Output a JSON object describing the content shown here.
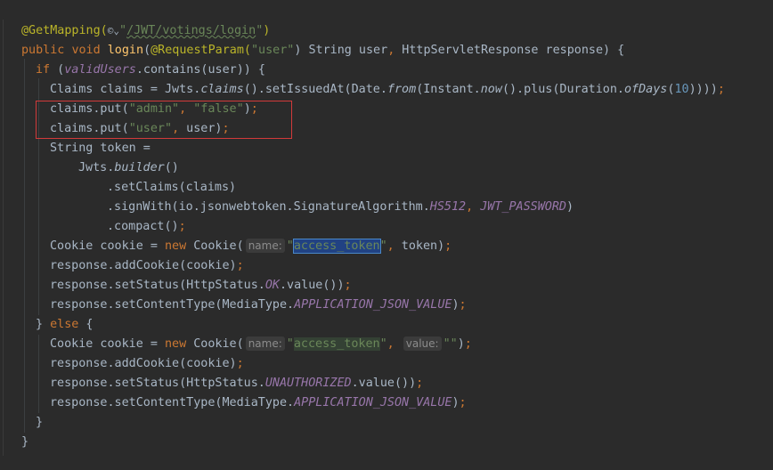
{
  "code": {
    "l1": {
      "ann": "@GetMapping(",
      "icon": "©⌄",
      "q1": "\"",
      "url": "/JWT/votings/login",
      "q2": "\"",
      "end": ")"
    },
    "l2": {
      "kw1": "public",
      "sp1": " ",
      "kw2": "void",
      "sp2": " ",
      "fn": "login",
      "p1": "(",
      "ann": "@RequestParam(",
      "str": "\"user\"",
      "p2": ") String user",
      "comma": ",",
      "rest": " HttpServletResponse response) {"
    },
    "l3": {
      "kw": "if",
      "p1": " (",
      "field": "validUsers",
      "rest": ".contains(user)) {"
    },
    "l4": {
      "a": "Claims claims = Jwts.",
      "m1": "claims",
      "b": "().setIssuedAt(Date.",
      "m2": "from",
      "c": "(Instant.",
      "m3": "now",
      "d": "().plus(Duration.",
      "m4": "ofDays",
      "e": "(",
      "num": "10",
      "f": "))))",
      "semi": ";"
    },
    "l5": {
      "a": "claims.put(",
      "s1": "\"admin\"",
      "comma": ",",
      "s2": " \"false\"",
      "b": ")",
      "semi": ";"
    },
    "l6": {
      "a": "claims.put(",
      "s1": "\"user\"",
      "comma": ",",
      "b": " user)",
      "semi": ";"
    },
    "l7": {
      "a": "String token ="
    },
    "l8": {
      "a": "Jwts.",
      "m": "builder",
      "b": "()"
    },
    "l9": {
      "a": ".setClaims(claims)"
    },
    "l10": {
      "a": ".signWith(io.jsonwebtoken.SignatureAlgorithm.",
      "f1": "HS512",
      "comma": ",",
      "f2": " JWT_PASSWORD",
      "b": ")"
    },
    "l11": {
      "a": ".compact()",
      "semi": ";"
    },
    "l12": {
      "a": "Cookie cookie = ",
      "kw": "new",
      "b": " Cookie(",
      "hint": "name:",
      "q1": "\"",
      "s": "access_token",
      "q2": "\"",
      "comma": ",",
      "c": " token)",
      "semi": ";"
    },
    "l13": {
      "a": "response.addCookie(cookie)",
      "semi": ";"
    },
    "l14": {
      "a": "response.setStatus(HttpStatus.",
      "f": "OK",
      "b": ".value())",
      "semi": ";"
    },
    "l15": {
      "a": "response.setContentType(MediaType.",
      "f": "APPLICATION_JSON_VALUE",
      "b": ")",
      "semi": ";"
    },
    "l16": {
      "a": "} ",
      "kw": "else",
      "b": " {"
    },
    "l17": {
      "a": "Cookie cookie = ",
      "kw": "new",
      "b": " Cookie(",
      "hint1": "name:",
      "q1": "\"",
      "s": "access_token",
      "q2": "\"",
      "comma": ",",
      "hint2": "value:",
      "s2": "\"\"",
      "c": ")",
      "semi": ";"
    },
    "l18": {
      "a": "response.addCookie(cookie)",
      "semi": ";"
    },
    "l19": {
      "a": "response.setStatus(HttpStatus.",
      "f": "UNAUTHORIZED",
      "b": ".value())",
      "semi": ";"
    },
    "l20": {
      "a": "response.setContentType(MediaType.",
      "f": "APPLICATION_JSON_VALUE",
      "b": ")",
      "semi": ";"
    },
    "l21": {
      "a": "}"
    },
    "l22": {
      "a": "}"
    }
  }
}
